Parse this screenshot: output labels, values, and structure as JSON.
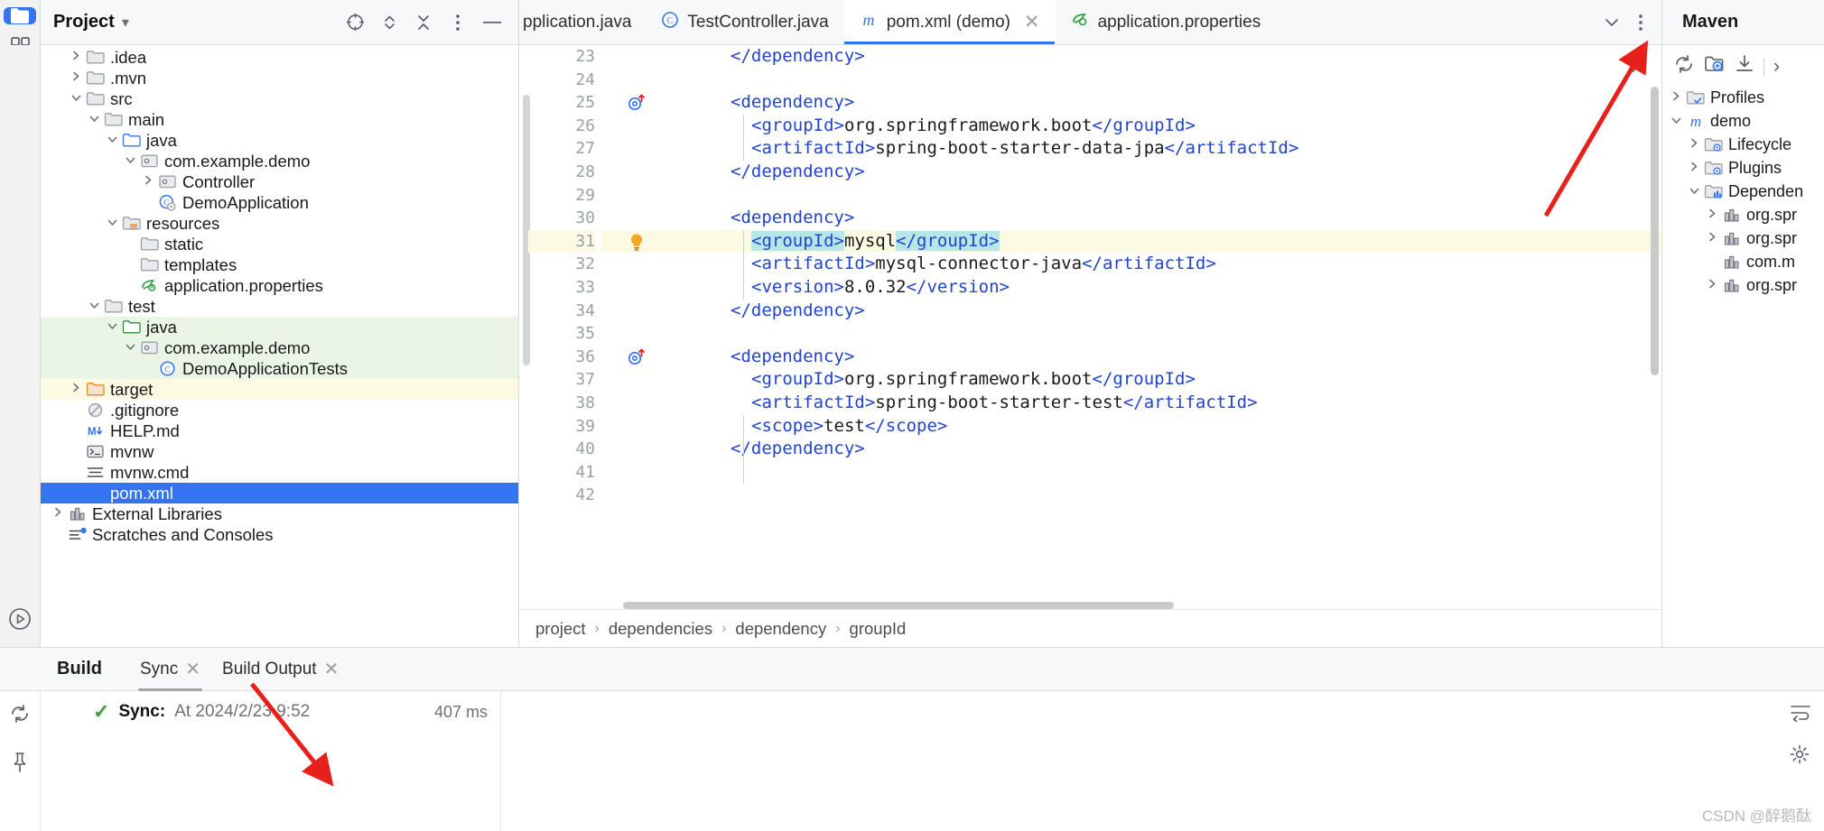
{
  "window": {
    "project_panel_title": "Project",
    "maven_panel_title": "Maven"
  },
  "activity_bar": {
    "items": [
      {
        "name": "project-folder-icon",
        "label": "Project"
      },
      {
        "name": "structure-icon",
        "label": "Structure"
      },
      {
        "name": "more-tool-windows-icon",
        "label": "More"
      }
    ],
    "bottom": [
      {
        "name": "run-icon",
        "label": "Run"
      }
    ]
  },
  "project_header_icons": [
    {
      "name": "select-opened-file-icon",
      "glyph": "⊕"
    },
    {
      "name": "expand-collapse-icon",
      "glyph": "⌃⌄"
    },
    {
      "name": "collapse-all-icon",
      "glyph": "✕"
    },
    {
      "name": "options-menu-icon",
      "glyph": "⋮"
    },
    {
      "name": "hide-icon",
      "glyph": "—"
    }
  ],
  "project_tree": [
    {
      "label": ".idea",
      "indent": 1,
      "arrow": "right",
      "icon": "folder",
      "state": "none"
    },
    {
      "label": ".mvn",
      "indent": 1,
      "arrow": "right",
      "icon": "folder",
      "state": "none"
    },
    {
      "label": "src",
      "indent": 1,
      "arrow": "down",
      "icon": "folder",
      "state": "none"
    },
    {
      "label": "main",
      "indent": 2,
      "arrow": "down",
      "icon": "folder",
      "state": "none"
    },
    {
      "label": "java",
      "indent": 3,
      "arrow": "down",
      "icon": "folder-source",
      "state": "none"
    },
    {
      "label": "com.example.demo",
      "indent": 4,
      "arrow": "down",
      "icon": "package",
      "state": "none"
    },
    {
      "label": "Controller",
      "indent": 5,
      "arrow": "right",
      "icon": "package",
      "state": "none"
    },
    {
      "label": "DemoApplication",
      "indent": 5,
      "arrow": "none",
      "icon": "class-run",
      "state": "none"
    },
    {
      "label": "resources",
      "indent": 3,
      "arrow": "down",
      "icon": "folder-res",
      "state": "none"
    },
    {
      "label": "static",
      "indent": 4,
      "arrow": "none",
      "icon": "folder",
      "state": "none"
    },
    {
      "label": "templates",
      "indent": 4,
      "arrow": "none",
      "icon": "folder",
      "state": "none"
    },
    {
      "label": "application.properties",
      "indent": 4,
      "arrow": "none",
      "icon": "spring",
      "state": "none"
    },
    {
      "label": "test",
      "indent": 2,
      "arrow": "down",
      "icon": "folder",
      "state": "none"
    },
    {
      "label": "java",
      "indent": 3,
      "arrow": "down",
      "icon": "folder-test",
      "state": "green"
    },
    {
      "label": "com.example.demo",
      "indent": 4,
      "arrow": "down",
      "icon": "package",
      "state": "green"
    },
    {
      "label": "DemoApplicationTests",
      "indent": 5,
      "arrow": "none",
      "icon": "class",
      "state": "green"
    },
    {
      "label": "target",
      "indent": 1,
      "arrow": "right",
      "icon": "folder-target",
      "state": "yellow"
    },
    {
      "label": ".gitignore",
      "indent": 1,
      "arrow": "none",
      "icon": "gitignore",
      "state": "none"
    },
    {
      "label": "HELP.md",
      "indent": 1,
      "arrow": "none",
      "icon": "markdown",
      "state": "none"
    },
    {
      "label": "mvnw",
      "indent": 1,
      "arrow": "none",
      "icon": "shell",
      "state": "none"
    },
    {
      "label": "mvnw.cmd",
      "indent": 1,
      "arrow": "none",
      "icon": "textfile",
      "state": "none"
    },
    {
      "label": "pom.xml",
      "indent": 1,
      "arrow": "none",
      "icon": "maven",
      "state": "selected"
    },
    {
      "label": "External Libraries",
      "indent": 0,
      "arrow": "right",
      "icon": "library",
      "state": "none"
    },
    {
      "label": "Scratches and Consoles",
      "indent": 0,
      "arrow": "none",
      "icon": "scratches",
      "state": "none"
    }
  ],
  "editor_tabs": [
    {
      "label": "pplication.java",
      "icon": "class",
      "active": false,
      "clipped": true,
      "closable": false
    },
    {
      "label": "TestController.java",
      "icon": "class",
      "active": false,
      "clipped": false,
      "closable": false
    },
    {
      "label": "pom.xml (demo)",
      "icon": "maven",
      "active": true,
      "clipped": false,
      "closable": true
    },
    {
      "label": "application.properties",
      "icon": "spring",
      "active": false,
      "clipped": false,
      "closable": false
    }
  ],
  "tabstrip_right_icons": [
    {
      "name": "tab-list-chevron-down-icon",
      "glyph": "⌄"
    },
    {
      "name": "tab-options-icon",
      "glyph": "⋮"
    }
  ],
  "editor": {
    "inspection_status": "✓",
    "first_line": 23,
    "lines": [
      {
        "n": 23,
        "indent": 2,
        "gutter": "",
        "hl": false,
        "parts": [
          {
            "t": "tag",
            "v": "</dependency>"
          }
        ]
      },
      {
        "n": 24,
        "indent": 0,
        "gutter": "",
        "hl": false,
        "parts": []
      },
      {
        "n": 25,
        "indent": 2,
        "gutter": "override",
        "hl": false,
        "parts": [
          {
            "t": "tag",
            "v": "<dependency>"
          }
        ]
      },
      {
        "n": 26,
        "indent": 3,
        "gutter": "",
        "hl": false,
        "parts": [
          {
            "t": "tag",
            "v": "<groupId>"
          },
          {
            "t": "txt",
            "v": "org.springframework.boot"
          },
          {
            "t": "tag",
            "v": "</groupId>"
          }
        ]
      },
      {
        "n": 27,
        "indent": 3,
        "gutter": "",
        "hl": false,
        "parts": [
          {
            "t": "tag",
            "v": "<artifactId>"
          },
          {
            "t": "txt",
            "v": "spring-boot-starter-data-jpa"
          },
          {
            "t": "tag",
            "v": "</artifactId>"
          }
        ]
      },
      {
        "n": 28,
        "indent": 2,
        "gutter": "",
        "hl": false,
        "parts": [
          {
            "t": "tag",
            "v": "</dependency>"
          }
        ]
      },
      {
        "n": 29,
        "indent": 0,
        "gutter": "",
        "hl": false,
        "parts": []
      },
      {
        "n": 30,
        "indent": 2,
        "gutter": "",
        "hl": false,
        "parts": [
          {
            "t": "tag",
            "v": "<dependency>"
          }
        ]
      },
      {
        "n": 31,
        "indent": 3,
        "gutter": "bulb",
        "hl": true,
        "parts": [
          {
            "t": "tag mark",
            "v": "<groupId>"
          },
          {
            "t": "txt",
            "v": "mysql"
          },
          {
            "t": "tag mark",
            "v": "</groupId>"
          }
        ]
      },
      {
        "n": 32,
        "indent": 3,
        "gutter": "",
        "hl": false,
        "parts": [
          {
            "t": "tag",
            "v": "<artifactId>"
          },
          {
            "t": "txt",
            "v": "mysql-connector-java"
          },
          {
            "t": "tag",
            "v": "</artifactId>"
          }
        ]
      },
      {
        "n": 33,
        "indent": 3,
        "gutter": "",
        "hl": false,
        "parts": [
          {
            "t": "tag",
            "v": "<version>"
          },
          {
            "t": "txt",
            "v": "8.0.32"
          },
          {
            "t": "tag",
            "v": "</version>"
          }
        ]
      },
      {
        "n": 34,
        "indent": 2,
        "gutter": "",
        "hl": false,
        "parts": [
          {
            "t": "tag",
            "v": "</dependency>"
          }
        ]
      },
      {
        "n": 35,
        "indent": 0,
        "gutter": "",
        "hl": false,
        "parts": []
      },
      {
        "n": 36,
        "indent": 2,
        "gutter": "override",
        "hl": false,
        "parts": [
          {
            "t": "tag",
            "v": "<dependency>"
          }
        ]
      },
      {
        "n": 37,
        "indent": 3,
        "gutter": "",
        "hl": false,
        "parts": [
          {
            "t": "tag",
            "v": "<groupId>"
          },
          {
            "t": "txt",
            "v": "org.springframework.boot"
          },
          {
            "t": "tag",
            "v": "</groupId>"
          }
        ]
      },
      {
        "n": 38,
        "indent": 3,
        "gutter": "",
        "hl": false,
        "parts": [
          {
            "t": "tag",
            "v": "<artifactId>"
          },
          {
            "t": "txt",
            "v": "spring-boot-starter-test"
          },
          {
            "t": "tag",
            "v": "</artifactId>"
          }
        ]
      },
      {
        "n": 39,
        "indent": 3,
        "gutter": "",
        "hl": false,
        "parts": [
          {
            "t": "tag",
            "v": "<scope>"
          },
          {
            "t": "txt",
            "v": "test"
          },
          {
            "t": "tag",
            "v": "</scope>"
          }
        ]
      },
      {
        "n": 40,
        "indent": 2,
        "gutter": "",
        "hl": false,
        "parts": [
          {
            "t": "tag",
            "v": "</dependency>"
          }
        ]
      },
      {
        "n": 41,
        "indent": 0,
        "gutter": "",
        "hl": false,
        "parts": []
      },
      {
        "n": 42,
        "indent": 0,
        "gutter": "",
        "hl": false,
        "parts": []
      }
    ],
    "breadcrumb": [
      "project",
      "dependencies",
      "dependency",
      "groupId"
    ]
  },
  "maven": {
    "toolbar": [
      {
        "name": "reload-all-maven-projects-icon",
        "glyph": "↻"
      },
      {
        "name": "add-maven-project-icon",
        "glyph": "⊞"
      },
      {
        "name": "download-sources-icon",
        "glyph": "⤓"
      },
      {
        "name": "expand-more-icon",
        "glyph": "›"
      }
    ],
    "tree": [
      {
        "label": "Profiles",
        "indent": 0,
        "arrow": "right",
        "icon": "folder-check"
      },
      {
        "label": "demo",
        "indent": 0,
        "arrow": "down",
        "icon": "maven"
      },
      {
        "label": "Lifecycle",
        "indent": 1,
        "arrow": "right",
        "icon": "folder-gear"
      },
      {
        "label": "Plugins",
        "indent": 1,
        "arrow": "right",
        "icon": "folder-gear"
      },
      {
        "label": "Dependen",
        "indent": 1,
        "arrow": "down",
        "icon": "folder-lib"
      },
      {
        "label": "org.spr",
        "indent": 2,
        "arrow": "right",
        "icon": "library"
      },
      {
        "label": "org.spr",
        "indent": 2,
        "arrow": "right",
        "icon": "library"
      },
      {
        "label": "com.m",
        "indent": 2,
        "arrow": "none",
        "icon": "library"
      },
      {
        "label": "org.spr",
        "indent": 2,
        "arrow": "right",
        "icon": "library"
      }
    ]
  },
  "build": {
    "title": "Build",
    "tabs": [
      {
        "label": "Sync",
        "active": true,
        "closable": true
      },
      {
        "label": "Build Output",
        "active": false,
        "closable": true
      }
    ],
    "rail_icons": [
      {
        "name": "rerun-sync-icon",
        "glyph": "↻"
      },
      {
        "name": "pin-tab-icon",
        "glyph": "⚐"
      }
    ],
    "sync": {
      "status_icon": "✓",
      "label": "Sync:",
      "detail": "At 2024/2/23 9:52",
      "duration": "407 ms"
    },
    "right_icons": [
      {
        "name": "soft-wrap-icon",
        "glyph": "↵"
      },
      {
        "name": "settings-icon",
        "glyph": "⚙"
      }
    ]
  },
  "watermark": "CSDN @醉鹅酞",
  "colors": {
    "accent_blue": "#3574f0",
    "tag_blue": "#2244cc",
    "highlight_line": "#fdfae3",
    "test_source_green": "#eaf6e5",
    "target_yellow": "#fdfae3",
    "match_cyan": "#b6e6e6",
    "ok_green": "#3a9e3a",
    "arrow_red": "#e8201b"
  }
}
